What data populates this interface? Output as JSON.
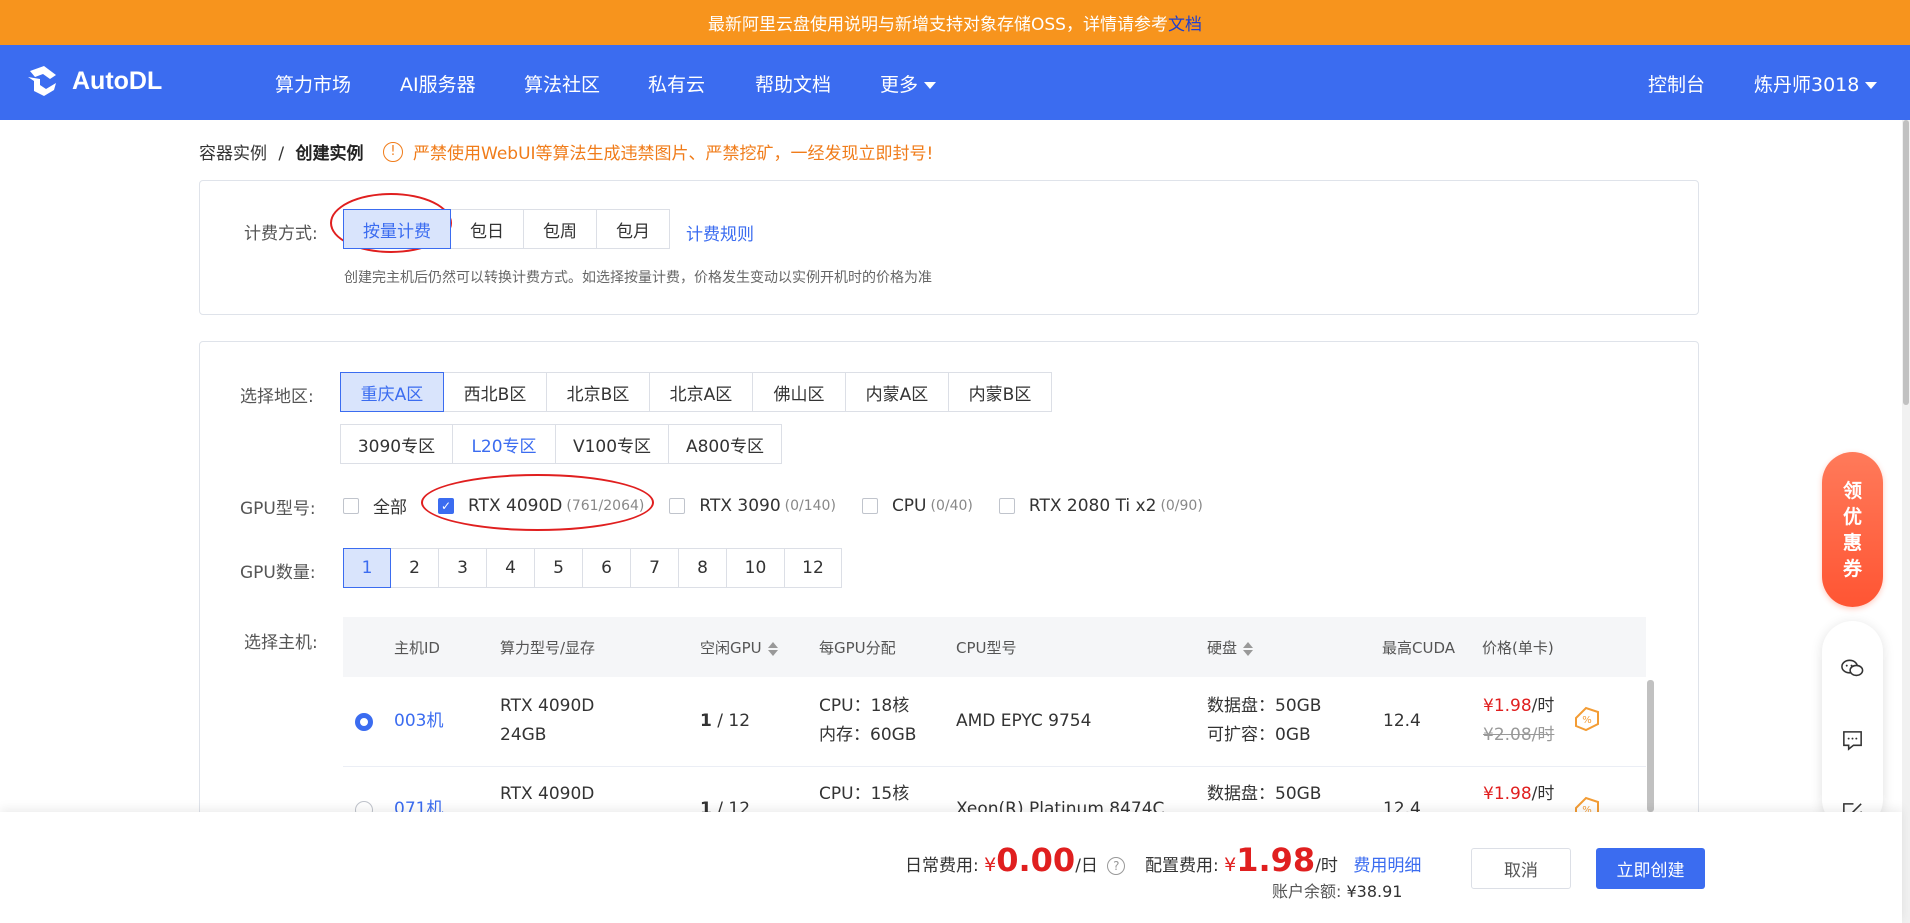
{
  "announcement": {
    "text": "最新阿里云盘使用说明与新增支持对象存储OSS，详情请参考",
    "link": "文档"
  },
  "nav": {
    "logo": "AutoDL",
    "items": [
      "算力市场",
      "AI服务器",
      "算法社区",
      "私有云",
      "帮助文档",
      "更多"
    ],
    "console": "控制台",
    "user": "炼丹师3018"
  },
  "breadcrumb": {
    "parent": "容器实例",
    "separator": "/",
    "current": "创建实例"
  },
  "warning": "严禁使用WebUI等算法生成违禁图片、严禁挖矿，一经发现立即封号!",
  "billing": {
    "label": "计费方式:",
    "options": [
      "按量计费",
      "包日",
      "包周",
      "包月"
    ],
    "rules_link": "计费规则",
    "hint": "创建完主机后仍然可以转换计费方式。如选择按量计费，价格发生变动以实例开机时的价格为准"
  },
  "region": {
    "label": "选择地区:",
    "row1": [
      "重庆A区",
      "西北B区",
      "北京B区",
      "北京A区",
      "佛山区",
      "内蒙A区",
      "内蒙B区"
    ],
    "row2": [
      "3090专区",
      "L20专区",
      "V100专区",
      "A800专区"
    ]
  },
  "gpu_type": {
    "label": "GPU型号:",
    "options": [
      {
        "name": "全部",
        "count": "",
        "checked": false
      },
      {
        "name": "RTX 4090D",
        "count": "(761/2064)",
        "checked": true
      },
      {
        "name": "RTX 3090",
        "count": "(0/140)",
        "checked": false
      },
      {
        "name": "CPU",
        "count": "(0/40)",
        "checked": false
      },
      {
        "name": "RTX 2080 Ti x2",
        "count": "(0/90)",
        "checked": false
      }
    ]
  },
  "gpu_count": {
    "label": "GPU数量:",
    "options": [
      "1",
      "2",
      "3",
      "4",
      "5",
      "6",
      "7",
      "8",
      "10",
      "12"
    ],
    "selected": "1"
  },
  "host": {
    "label": "选择主机:",
    "columns": [
      "主机ID",
      "算力型号/显存",
      "空闲GPU",
      "每GPU分配",
      "CPU型号",
      "硬盘",
      "最高CUDA",
      "价格(单卡)"
    ],
    "rows": [
      {
        "id": "003机",
        "gpu_model": "RTX 4090D",
        "vram": "24GB",
        "free_gpu": "1",
        "total_gpu": "/ 12",
        "cpu_alloc": "CPU：18核",
        "mem_alloc": "内存：60GB",
        "cpu_model": "AMD EPYC 9754",
        "disk": "数据盘：50GB",
        "expand": "可扩容：0GB",
        "cuda": "12.4",
        "price": "¥1.98",
        "price_unit": "/时",
        "orig_price": "¥2.08/时",
        "selected": true
      },
      {
        "id": "071机",
        "gpu_model": "RTX 4090D",
        "vram": "",
        "free_gpu": "1",
        "total_gpu": "/ 12",
        "cpu_alloc": "CPU：15核",
        "mem_alloc": "",
        "cpu_model": "Xeon(R) Platinum 8474C",
        "disk": "数据盘：50GB",
        "expand": "",
        "cuda": "12.4",
        "price": "¥1.98",
        "price_unit": "/时",
        "orig_price": "",
        "selected": false
      }
    ]
  },
  "footer": {
    "daily_label": "日常费用:",
    "daily_yen": "¥",
    "daily_value": "0.00",
    "daily_unit": "/日",
    "config_label": "配置费用:",
    "config_yen": "¥",
    "config_value": "1.98",
    "config_unit": "/时",
    "detail_link": "费用明细",
    "balance_label": "账户余额:",
    "balance_value": "¥38.91",
    "cancel": "取消",
    "create": "立即创建"
  },
  "side": {
    "coupon": [
      "领",
      "优",
      "惠",
      "券"
    ]
  },
  "colors": {
    "primary": "#3b6cf0",
    "announce": "#f7941d",
    "warning": "#f07c1a",
    "price": "#e01f1f"
  }
}
